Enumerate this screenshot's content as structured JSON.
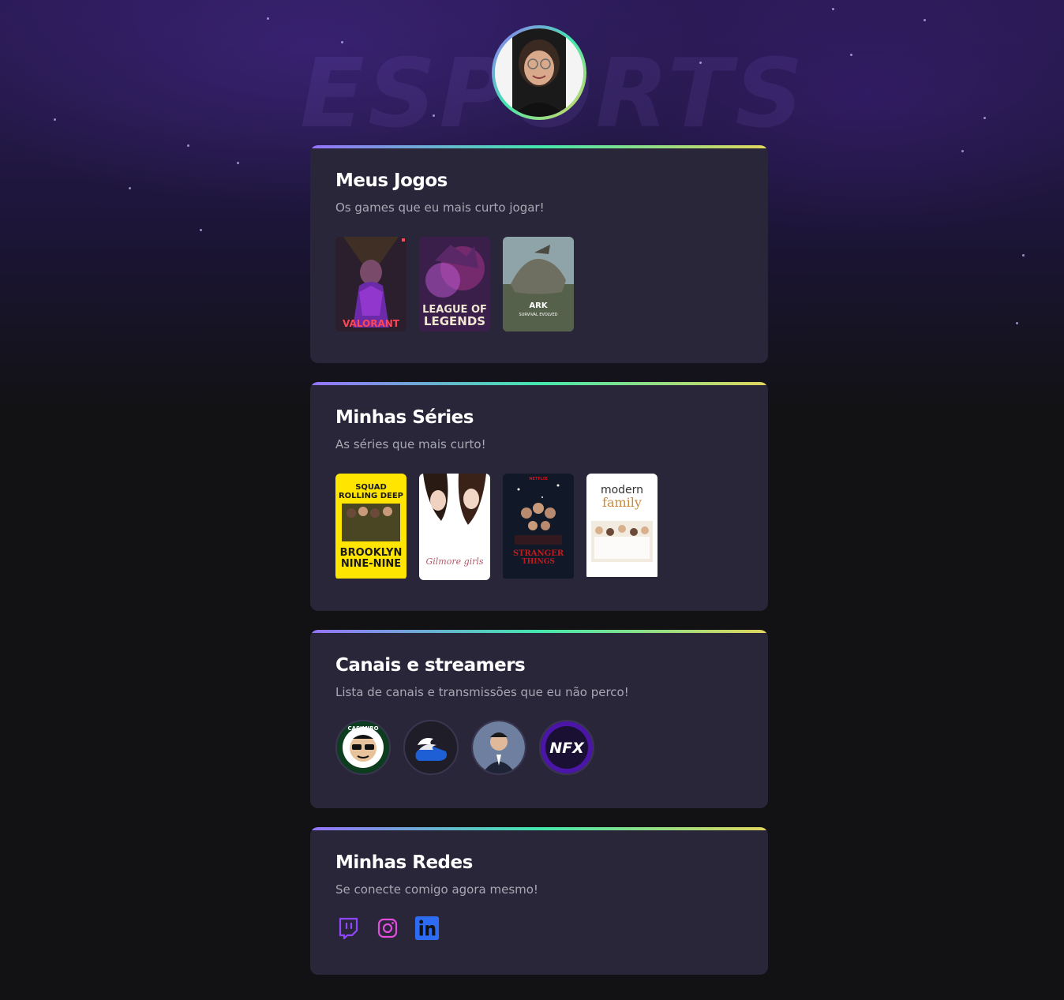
{
  "profile": {
    "avatar_icon": "avatar-photo"
  },
  "sections": {
    "games": {
      "title": "Meus Jogos",
      "subtitle": "Os games que eu mais curto jogar!",
      "items": [
        {
          "label": "VALORANT",
          "accent": "#ff4655"
        },
        {
          "label_line1": "LEAGUE OF",
          "label_line2": "LEGENDS",
          "accent": "#c89b3c"
        },
        {
          "label": "ARK",
          "sub": "SURVIVAL EVOLVED",
          "accent": "#6ec1e4"
        }
      ]
    },
    "series": {
      "title": "Minhas Séries",
      "subtitle": "As séries que mais curto!",
      "items": [
        {
          "top1": "SQUAD",
          "top2": "ROLLING DEEP",
          "title1": "BROOKLYN",
          "title2": "NINE-NINE",
          "bg": "#ffe500"
        },
        {
          "label": "Gilmore girls",
          "bg": "#ffffff"
        },
        {
          "network": "NETFLIX",
          "label1": "STRANGER",
          "label2": "THINGS",
          "bg": "#111827"
        },
        {
          "label1": "modern",
          "label2": "family",
          "bg": "#ffffff"
        }
      ]
    },
    "channels": {
      "title": "Canais e streamers",
      "subtitle": "Lista de canais e transmissões que eu não perco!",
      "items": [
        {
          "label": "CASIMIRO",
          "icon": "casimiro-logo-icon"
        },
        {
          "icon": "wing-shoe-logo-icon"
        },
        {
          "icon": "streamer-photo-icon"
        },
        {
          "label": "NFX",
          "icon": "nfx-logo-icon"
        }
      ]
    },
    "socials": {
      "title": "Minhas Redes",
      "subtitle": "Se conecte comigo agora mesmo!",
      "items": [
        {
          "icon": "twitch-icon",
          "color": "#9147ff"
        },
        {
          "icon": "instagram-icon",
          "color": "#e24ddb"
        },
        {
          "icon": "linkedin-icon",
          "color": "#2d6cf2"
        }
      ]
    }
  },
  "background": {
    "watermark": "ESPORTS"
  }
}
